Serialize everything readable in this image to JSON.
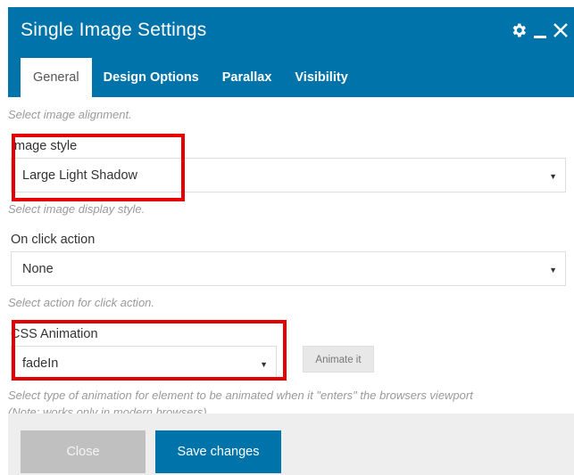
{
  "header": {
    "title": "Single Image Settings",
    "icons": [
      "gear-icon",
      "minimize-icon",
      "close-icon"
    ]
  },
  "tabs": [
    {
      "label": "General",
      "active": true
    },
    {
      "label": "Design Options",
      "active": false
    },
    {
      "label": "Parallax",
      "active": false
    },
    {
      "label": "Visibility",
      "active": false
    }
  ],
  "fields": {
    "alignment_hint": "Select image alignment.",
    "image_style": {
      "label": "Image style",
      "value": "Large Light Shadow",
      "hint": "Select image display style."
    },
    "on_click": {
      "label": "On click action",
      "value": "None",
      "hint": "Select action for click action."
    },
    "css_animation": {
      "label": "CSS Animation",
      "value": "fadeIn",
      "button": "Animate it",
      "hint_line1": "Select type of animation for element to be animated when it \"enters\" the browsers viewport",
      "hint_line2": "(Note: works only in modern browsers)."
    }
  },
  "footer": {
    "close_label": "Close",
    "save_label": "Save changes"
  },
  "colors": {
    "header_bg": "#0073aa",
    "highlight": "#e60000",
    "footer_bg": "#eeeeee"
  }
}
